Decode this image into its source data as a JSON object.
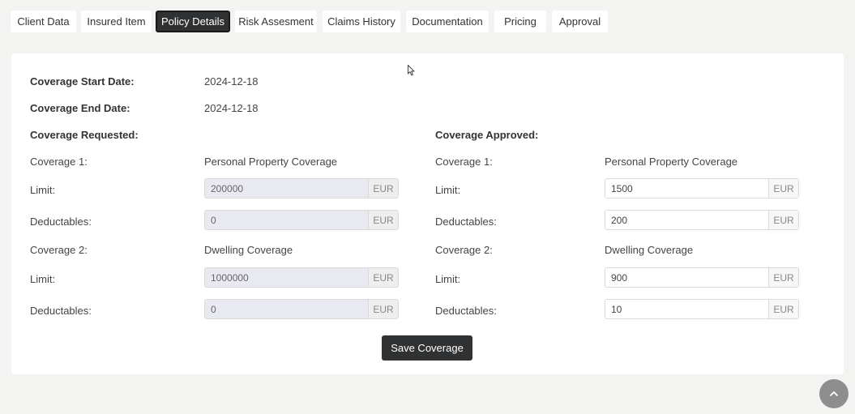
{
  "tabs": [
    {
      "label": "Client Data"
    },
    {
      "label": "Insured Item"
    },
    {
      "label": "Policy Details"
    },
    {
      "label": "Risk Assesment"
    },
    {
      "label": "Claims History"
    },
    {
      "label": "Documentation"
    },
    {
      "label": "Pricing"
    },
    {
      "label": "Approval"
    }
  ],
  "active_tab": "Policy Details",
  "policy": {
    "start_label": "Coverage Start Date:",
    "start_value": "2024-12-18",
    "end_label": "Coverage End Date:",
    "end_value": "2024-12-18",
    "requested": {
      "heading": "Coverage Requested:",
      "cov1_label": "Coverage 1:",
      "cov1_name": "Personal Property Coverage",
      "cov1_limit_label": "Limit:",
      "cov1_limit": "200000",
      "cov1_ded_label": "Deductables:",
      "cov1_ded": "0",
      "cov2_label": "Coverage 2:",
      "cov2_name": "Dwelling Coverage",
      "cov2_limit_label": "Limit:",
      "cov2_limit": "1000000",
      "cov2_ded_label": "Deductables:",
      "cov2_ded": "0"
    },
    "approved": {
      "heading": "Coverage Approved:",
      "cov1_label": "Coverage 1:",
      "cov1_name": "Personal Property Coverage",
      "cov1_limit_label": "Limit:",
      "cov1_limit": "1500",
      "cov1_ded_label": "Deductables:",
      "cov1_ded": "200",
      "cov2_label": "Coverage 2:",
      "cov2_name": "Dwelling Coverage",
      "cov2_limit_label": "Limit:",
      "cov2_limit": "900",
      "cov2_ded_label": "Deductables:",
      "cov2_ded": "10"
    },
    "currency": "EUR",
    "save_label": "Save Coverage"
  },
  "icons": {
    "scroll_top": "chevron-up-icon",
    "cursor": "mouse-pointer-icon"
  },
  "colors": {
    "background": "#f3f3f2",
    "active_tab": "#2f3133",
    "disabled_input": "#e9e9f2"
  }
}
